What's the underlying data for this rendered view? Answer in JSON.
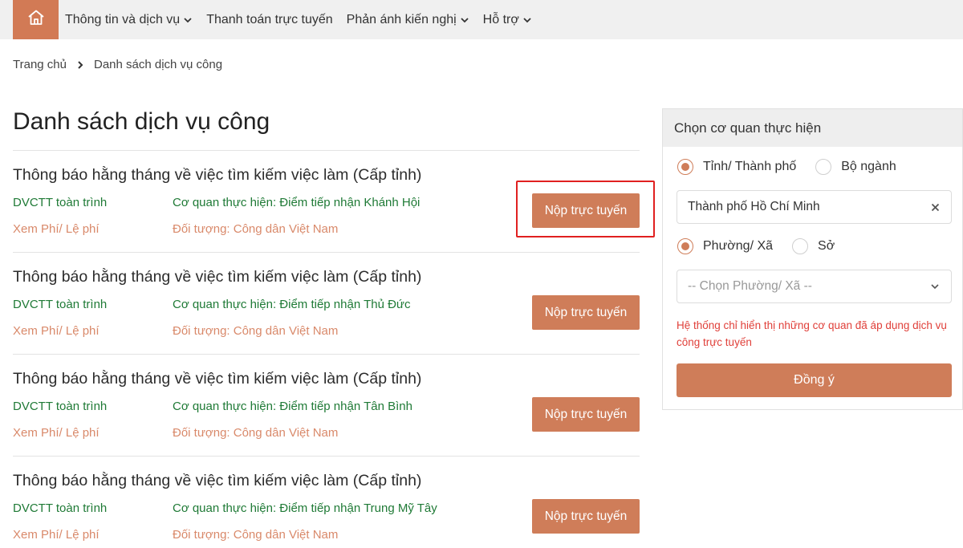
{
  "nav": {
    "items": [
      {
        "label": "Thông tin và dịch vụ",
        "has_dropdown": true
      },
      {
        "label": "Thanh toán trực tuyến",
        "has_dropdown": false
      },
      {
        "label": "Phản ánh kiến nghị",
        "has_dropdown": true
      },
      {
        "label": "Hỗ trợ",
        "has_dropdown": true
      }
    ],
    "home_icon": "home-icon"
  },
  "breadcrumb": {
    "home": "Trang chủ",
    "current": "Danh sách dịch vụ công"
  },
  "page_title": "Danh sách dịch vụ công",
  "services": [
    {
      "title": "Thông báo hằng tháng về việc tìm kiếm việc làm (Cấp tỉnh)",
      "type": "DVCTT toàn trình",
      "agency": "Cơ quan thực hiện: Điểm tiếp nhận Khánh Hội",
      "fee": "Xem Phí/ Lệ phí",
      "target": "Đối tượng: Công dân Việt Nam",
      "button": "Nộp trực tuyến"
    },
    {
      "title": "Thông báo hằng tháng về việc tìm kiếm việc làm (Cấp tỉnh)",
      "type": "DVCTT toàn trình",
      "agency": "Cơ quan thực hiện: Điểm tiếp nhận Thủ Đức",
      "fee": "Xem Phí/ Lệ phí",
      "target": "Đối tượng: Công dân Việt Nam",
      "button": "Nộp trực tuyến"
    },
    {
      "title": "Thông báo hằng tháng về việc tìm kiếm việc làm (Cấp tỉnh)",
      "type": "DVCTT toàn trình",
      "agency": "Cơ quan thực hiện: Điểm tiếp nhận Tân Bình",
      "fee": "Xem Phí/ Lệ phí",
      "target": "Đối tượng: Công dân Việt Nam",
      "button": "Nộp trực tuyến"
    },
    {
      "title": "Thông báo hằng tháng về việc tìm kiếm việc làm (Cấp tỉnh)",
      "type": "DVCTT toàn trình",
      "agency": "Cơ quan thực hiện: Điểm tiếp nhận Trung Mỹ Tây",
      "fee": "Xem Phí/ Lệ phí",
      "target": "Đối tượng: Công dân Việt Nam",
      "button": "Nộp trực tuyến"
    }
  ],
  "panel": {
    "title": "Chọn cơ quan thực hiện",
    "level_options": [
      {
        "label": "Tỉnh/ Thành phố",
        "selected": true
      },
      {
        "label": "Bộ ngành",
        "selected": false
      }
    ],
    "province_value": "Thành phố Hồ Chí Minh",
    "sub_options": [
      {
        "label": "Phường/ Xã",
        "selected": true
      },
      {
        "label": "Sở",
        "selected": false
      }
    ],
    "ward_placeholder": "-- Chọn Phường/ Xã --",
    "note": "Hệ thống chỉ hiển thị những cơ quan đã áp dụng dịch vụ công trực tuyến",
    "agree_button": "Đồng ý"
  },
  "colors": {
    "accent": "#cf7d59",
    "green_text": "#1f7a36",
    "orange_text": "#d9896a",
    "note_red": "#e0403a",
    "highlight": "#e02020"
  }
}
